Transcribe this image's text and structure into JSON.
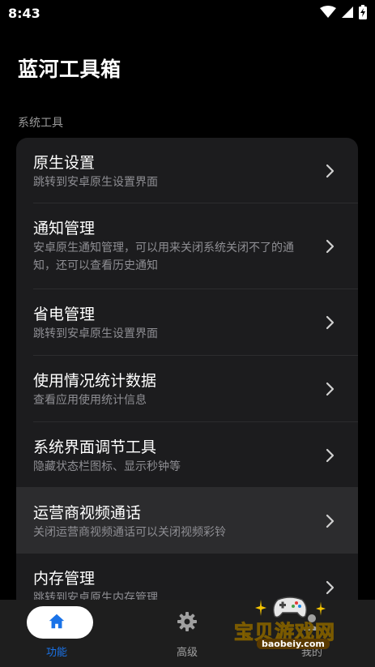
{
  "status_bar": {
    "time": "8:43"
  },
  "header": {
    "title": "蓝河工具箱"
  },
  "section": {
    "label": "系统工具"
  },
  "items": [
    {
      "title": "原生设置",
      "subtitle": "跳转到安卓原生设置界面"
    },
    {
      "title": "通知管理",
      "subtitle": "安卓原生通知管理，可以用来关闭系统关闭不了的通知，还可以查看历史通知"
    },
    {
      "title": "省电管理",
      "subtitle": "跳转到安卓原生设置界面"
    },
    {
      "title": "使用情况统计数据",
      "subtitle": "查看应用使用统计信息"
    },
    {
      "title": "系统界面调节工具",
      "subtitle": "隐藏状态栏图标、显示秒钟等"
    },
    {
      "title": "运营商视频通话",
      "subtitle": "关闭运营商视频通话可以关闭视频彩铃"
    },
    {
      "title": "内存管理",
      "subtitle": "跳转到安卓原生内存管理"
    }
  ],
  "bottom_nav": {
    "items": [
      {
        "label": "功能",
        "icon": "home-icon",
        "active": true
      },
      {
        "label": "高级",
        "icon": "gear-icon",
        "active": false
      },
      {
        "label": "我的",
        "icon": "person-icon",
        "active": false
      }
    ]
  },
  "watermark": {
    "text": "宝贝游戏网",
    "url": "baobeiy.com"
  },
  "colors": {
    "accent": "#1a73e8",
    "card": "#1c1c1e",
    "pressed": "#2c2c2e",
    "subtitle": "#8e8e93"
  }
}
